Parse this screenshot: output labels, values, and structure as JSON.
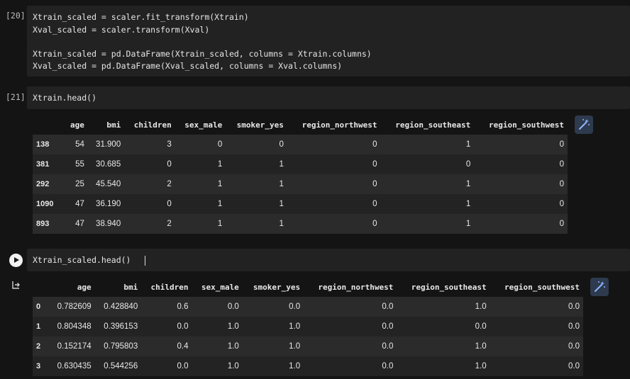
{
  "cell20": {
    "count": "[20]",
    "lines": [
      "Xtrain_scaled = scaler.fit_transform(Xtrain)",
      "Xval_scaled = scaler.transform(Xval)",
      "",
      "Xtrain_scaled = pd.DataFrame(Xtrain_scaled, columns = Xtrain.columns)",
      "Xval_scaled = pd.DataFrame(Xval_scaled, columns = Xval.columns)"
    ]
  },
  "cell21": {
    "count": "[21]",
    "code": "Xtrain.head()",
    "table": {
      "columns": [
        "",
        "age",
        "bmi",
        "children",
        "sex_male",
        "smoker_yes",
        "region_northwest",
        "region_southeast",
        "region_southwest"
      ],
      "rows": [
        [
          "138",
          "54",
          "31.900",
          "3",
          "0",
          "0",
          "0",
          "1",
          "0"
        ],
        [
          "381",
          "55",
          "30.685",
          "0",
          "1",
          "1",
          "0",
          "0",
          "0"
        ],
        [
          "292",
          "25",
          "45.540",
          "2",
          "1",
          "1",
          "0",
          "1",
          "0"
        ],
        [
          "1090",
          "47",
          "36.190",
          "0",
          "1",
          "1",
          "0",
          "1",
          "0"
        ],
        [
          "893",
          "47",
          "38.940",
          "2",
          "1",
          "1",
          "0",
          "1",
          "0"
        ]
      ]
    }
  },
  "cell22": {
    "code": "Xtrain_scaled.head()",
    "table": {
      "columns": [
        "",
        "age",
        "bmi",
        "children",
        "sex_male",
        "smoker_yes",
        "region_northwest",
        "region_southeast",
        "region_southwest"
      ],
      "rows": [
        [
          "0",
          "0.782609",
          "0.428840",
          "0.6",
          "0.0",
          "0.0",
          "0.0",
          "1.0",
          "0.0"
        ],
        [
          "1",
          "0.804348",
          "0.396153",
          "0.0",
          "1.0",
          "1.0",
          "0.0",
          "0.0",
          "0.0"
        ],
        [
          "2",
          "0.152174",
          "0.795803",
          "0.4",
          "1.0",
          "1.0",
          "0.0",
          "1.0",
          "0.0"
        ],
        [
          "3",
          "0.630435",
          "0.544256",
          "0.0",
          "1.0",
          "1.0",
          "0.0",
          "1.0",
          "0.0"
        ]
      ]
    }
  },
  "colors": {
    "background": "#141414",
    "code_cell": "#222222",
    "row_odd": "#2b2b2b",
    "row_even": "#232323",
    "wand_button": "#2e3a4d",
    "wand_icon": "#8fb4ff"
  }
}
